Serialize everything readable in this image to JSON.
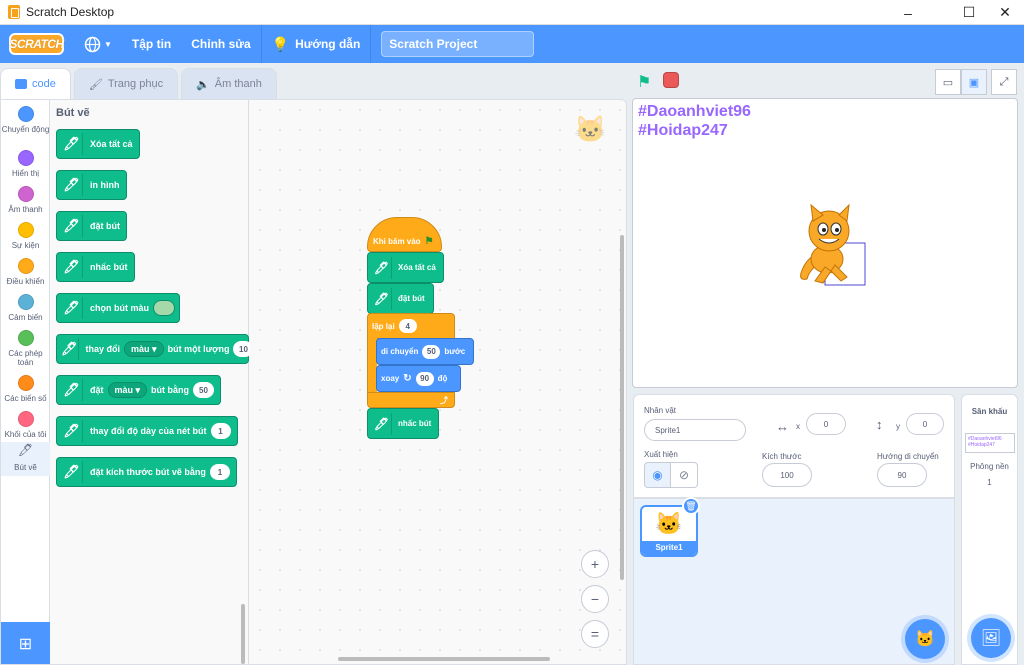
{
  "window": {
    "title": "Scratch Desktop",
    "minimize": "–",
    "maximize": "☐",
    "close": "✕"
  },
  "menu": {
    "logo": "SCRATCH",
    "language_icon": "globe-icon",
    "file": "Tập tin",
    "edit": "Chỉnh sửa",
    "tutorials": "Hướng dẫn",
    "project_title": "Scratch Project"
  },
  "tabs": [
    {
      "label": "code"
    },
    {
      "label": "Trang phục"
    },
    {
      "label": "Âm thanh"
    }
  ],
  "categories": [
    {
      "label": "Chuyển động",
      "color": "#4c97ff"
    },
    {
      "label": "Hiển thị",
      "color": "#9966ff"
    },
    {
      "label": "Âm thanh",
      "color": "#cf63cf"
    },
    {
      "label": "Sự kiện",
      "color": "#ffbf00"
    },
    {
      "label": "Điều khiển",
      "color": "#ffab19"
    },
    {
      "label": "Cảm biến",
      "color": "#5cb1d6"
    },
    {
      "label": "Các phép toán",
      "color": "#59c059"
    },
    {
      "label": "Các biến số",
      "color": "#ff8c1a"
    },
    {
      "label": "Khối của tôi",
      "color": "#ff6680"
    },
    {
      "label": "Bút vẽ",
      "color": "#0fbd8c"
    }
  ],
  "palette": {
    "title": "Bút vẽ",
    "blocks": {
      "clear": "Xóa tất cả",
      "stamp": "in hình",
      "pen_down": "đặt bút",
      "pen_up": "nhấc bút",
      "set_color_to": "chọn bút màu",
      "change_by_pre": "thay đổi",
      "change_by_dd": "màu",
      "change_by_mid": "bút một lượng",
      "change_by_val": "10",
      "set_to_pre": "đặt",
      "set_to_dd": "màu",
      "set_to_mid": "bút bằng",
      "set_to_val": "50",
      "change_size": "thay đổi độ dày của nét bút",
      "change_size_val": "1",
      "set_size": "đặt kích thước bút vẽ bằng",
      "set_size_val": "1"
    }
  },
  "script": {
    "hat": "Khi bấm vào",
    "clear": "Xóa tất cả",
    "pen_down": "đặt bút",
    "repeat": "lặp lại",
    "repeat_val": "4",
    "move_pre": "di chuyển",
    "move_val": "50",
    "move_post": "bước",
    "turn_pre": "xoay",
    "turn_val": "90",
    "turn_post": "độ",
    "pen_up": "nhấc bút"
  },
  "zoom": {
    "in": "+",
    "out": "−",
    "reset": "="
  },
  "stage": {
    "line1": "#Daoanhviet96",
    "line2": "#Hoidap247"
  },
  "sprite_info": {
    "sprite_label": "Nhân vật",
    "sprite_name": "Sprite1",
    "x_label": "x",
    "x_value": "0",
    "y_label": "y",
    "y_value": "0",
    "show_label": "Xuất hiện",
    "size_label": "Kích thước",
    "size_value": "100",
    "direction_label": "Hướng di chuyển",
    "direction_value": "90"
  },
  "sprite_list": [
    {
      "name": "Sprite1"
    }
  ],
  "stage_pane": {
    "title": "Sân khấu",
    "backdrops_label": "Phông nền",
    "backdrops_count": "1",
    "mini1": "#Daoanhviet96",
    "mini2": "#Hoidap247"
  }
}
